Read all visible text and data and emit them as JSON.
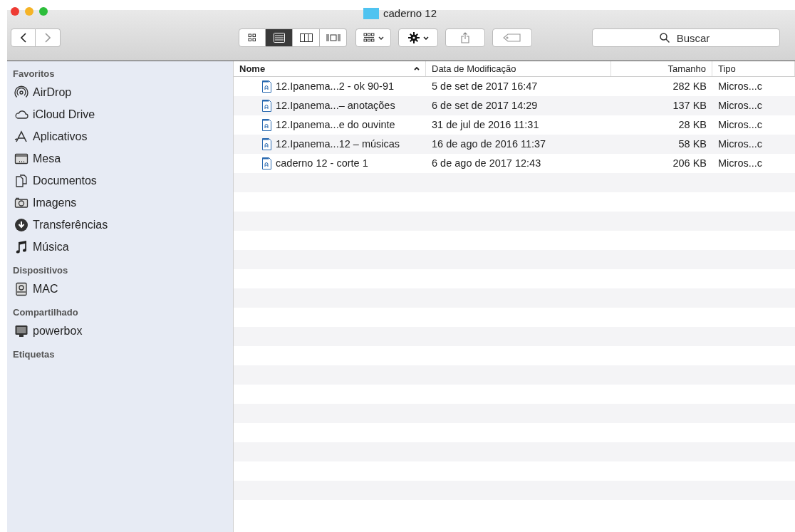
{
  "window": {
    "title": "caderno 12"
  },
  "toolbar": {
    "view_modes": [
      {
        "kind": "icons",
        "selected": false
      },
      {
        "kind": "list",
        "selected": true
      },
      {
        "kind": "columns",
        "selected": false
      },
      {
        "kind": "coverflow",
        "selected": false
      }
    ],
    "search": {
      "placeholder": "Buscar"
    }
  },
  "sidebar": {
    "sections": [
      {
        "title": "Favoritos",
        "items": [
          {
            "label": "AirDrop",
            "kind": "airdrop"
          },
          {
            "label": "iCloud Drive",
            "kind": "cloud"
          },
          {
            "label": "Aplicativos",
            "kind": "apps"
          },
          {
            "label": "Mesa",
            "kind": "desktop"
          },
          {
            "label": "Documentos",
            "kind": "documents"
          },
          {
            "label": "Imagens",
            "kind": "camera"
          },
          {
            "label": "Transferências",
            "kind": "download"
          },
          {
            "label": "Música",
            "kind": "music"
          }
        ]
      },
      {
        "title": "Dispositivos",
        "items": [
          {
            "label": "MAC",
            "kind": "disk"
          }
        ]
      },
      {
        "title": "Compartilhado",
        "items": [
          {
            "label": "powerbox",
            "kind": "monitor"
          }
        ]
      },
      {
        "title": "Etiquetas"
      }
    ]
  },
  "table": {
    "columns": [
      {
        "label": "Nome",
        "sorted": true
      },
      {
        "label": "Data de Modificação",
        "sorted": false
      },
      {
        "label": "Tamanho",
        "sorted": false
      },
      {
        "label": "Tipo",
        "sorted": false
      }
    ],
    "rows": [
      {
        "name": "12.Ipanema...2 - ok 90-91",
        "date": "5 de set de 2017 16:47",
        "size": "282 KB",
        "type": "Micros...c"
      },
      {
        "name": "12.Ipanema...– anotações",
        "date": "6 de set de 2017 14:29",
        "size": "137 KB",
        "type": "Micros...c"
      },
      {
        "name": "12.Ipanema...e do ouvinte",
        "date": "31 de jul de 2016 11:31",
        "size": "28 KB",
        "type": "Micros...c"
      },
      {
        "name": "12.Ipanema...12 – músicas",
        "date": "16 de ago de 2016 11:37",
        "size": "58 KB",
        "type": "Micros...c"
      },
      {
        "name": "caderno 12 - corte 1",
        "date": "6 de ago de 2017 12:43",
        "size": "206 KB",
        "type": "Micros...c"
      }
    ]
  }
}
